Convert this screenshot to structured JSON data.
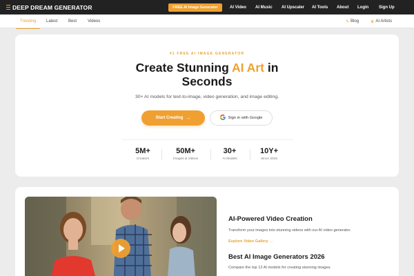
{
  "topnav": {
    "brand": "DEEP DREAM GENERATOR",
    "cta": "FREE AI Image Generator",
    "links": [
      "AI Video",
      "AI Music",
      "AI Upscaler",
      "AI Tools",
      "About",
      "Login",
      "Sign Up"
    ]
  },
  "subnav": {
    "tabs": [
      "Trending",
      "Latest",
      "Best",
      "Videos"
    ],
    "active_tab": "Trending",
    "right": [
      {
        "label": "Blog",
        "icon": "edit-icon"
      },
      {
        "label": "AI Artists",
        "icon": "trophy-icon"
      }
    ]
  },
  "hero": {
    "eyebrow": "#1 FREE AI IMAGE GENERATOR",
    "title_pre": "Create Stunning ",
    "title_accent": "AI Art",
    "title_post": " in",
    "title_line2": "Seconds",
    "subtitle": "30+ AI models for text-to-image, video generation, and image editing.",
    "start_button": "Start Creating",
    "google_button": "Sign in with Google",
    "stats": [
      {
        "value": "5M+",
        "label": "Creators"
      },
      {
        "value": "50M+",
        "label": "Images & Videos"
      },
      {
        "value": "30+",
        "label": "AI Models"
      },
      {
        "value": "10Y+",
        "label": "Since 2015"
      }
    ]
  },
  "feature": {
    "video_title": "AI-Powered Video Creation",
    "video_text": "Transform your images into stunning videos with our AI video generator.",
    "video_link": "Explore Video Gallery",
    "gen_title": "Best AI Image Generators 2026",
    "gen_text": "Compare the top 12 AI models for creating stunning images."
  },
  "colors": {
    "accent": "#f0a030",
    "nav_bg": "#222222"
  }
}
